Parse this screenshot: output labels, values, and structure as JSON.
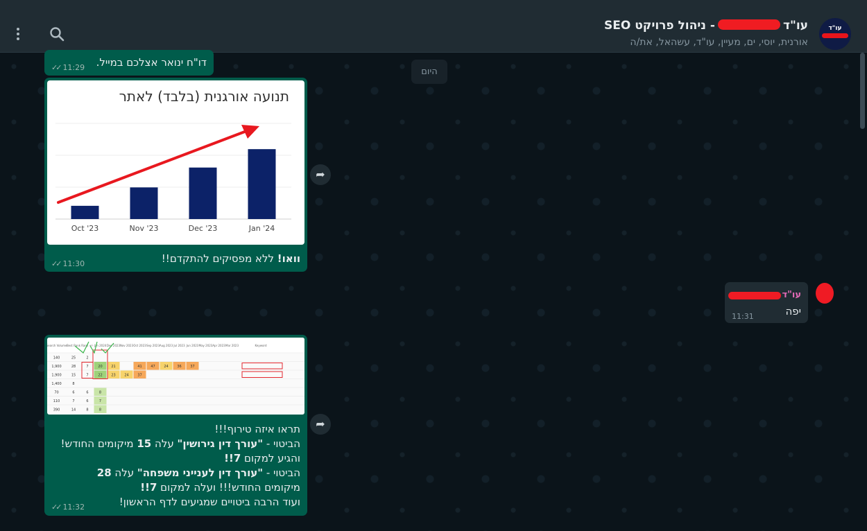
{
  "chat": {
    "title_prefix": "עו\"ד",
    "title_suffix": "- ניהול פרויקט SEO",
    "participants": "אורנית, יוסי, ים, מעיין, עו\"ד, עשהאל, את/ה",
    "avatar_label": "עו\"ד"
  },
  "date_chip": "היום",
  "messages": [
    {
      "text": "דו\"ח ינואר אצלכם במייל.",
      "time": "11:29"
    },
    {
      "bold": "וואו!",
      "text": " ללא מפסיקים להתקדם!!",
      "time": "11:30"
    },
    {
      "sender": "עו\"ד",
      "text": "יפה",
      "time": "11:31"
    },
    {
      "lines": [
        "תראו איזה טירוף!!!",
        "הביטוי - ",
        "\"עורך דין גירושין\"",
        " עלה ",
        "15",
        " מיקומים החודש!",
        "והגיע למקום ",
        "7!!",
        "הביטוי - ",
        "\"עורך דין לענייני משפחה\"",
        " עלה ",
        "28",
        "מיקומים החודש!!! ועלה למקום ",
        "7!!",
        "ועוד הרבה ביטויים שמגיעים לדף הראשון!"
      ],
      "time": "11:32"
    }
  ],
  "chart_data": {
    "type": "bar",
    "title": "תנועה אורגנית (בלבד) לאתר",
    "categories": [
      "Oct '23",
      "Nov '23",
      "Dec '23",
      "Jan '24"
    ],
    "values": [
      18,
      43,
      70,
      95
    ],
    "ylim": [
      0,
      130
    ],
    "grid": true,
    "annotation": "upward-trend-arrow",
    "colors": {
      "bar": "#0c2268",
      "arrow": "#e8181f"
    }
  },
  "ranking_table": {
    "header": [
      "Search Volume",
      "Best Rank",
      "Rank +/-",
      "Jan 2024",
      "Dec 2023",
      "Nov 2023",
      "Oct 2023",
      "Sep 2023",
      "Aug 2023",
      "Jul 2023",
      "Jun 2023",
      "May 2023",
      "Apr 2023",
      "Mar 2023",
      "Keyword"
    ],
    "rows": [
      [
        "140",
        "25",
        "2",
        "",
        "",
        "",
        "",
        "",
        "",
        "",
        "",
        "",
        "",
        "",
        ""
      ],
      [
        "1,900",
        "28",
        "7",
        "20",
        "21",
        "",
        "41",
        "47",
        "24",
        "36",
        "37",
        "",
        "",
        "",
        ""
      ],
      [
        "1,900",
        "15",
        "7",
        "22",
        "23",
        "24",
        "37",
        "",
        "",
        "",
        "",
        "",
        "",
        "",
        ""
      ],
      [
        "1,400",
        "8",
        "",
        "",
        "",
        "",
        "",
        "",
        "",
        "",
        "",
        "",
        "",
        "",
        ""
      ],
      [
        "70",
        "6",
        "6",
        "8",
        "",
        "",
        "",
        "",
        "",
        "",
        "",
        "",
        "",
        "",
        ""
      ],
      [
        "110",
        "7",
        "6",
        "7",
        "",
        "",
        "",
        "",
        "",
        "",
        "",
        "",
        "",
        "",
        ""
      ],
      [
        "390",
        "14",
        "8",
        "8",
        "",
        "",
        "",
        "",
        "",
        "",
        "",
        "",
        "",
        "",
        ""
      ]
    ]
  }
}
